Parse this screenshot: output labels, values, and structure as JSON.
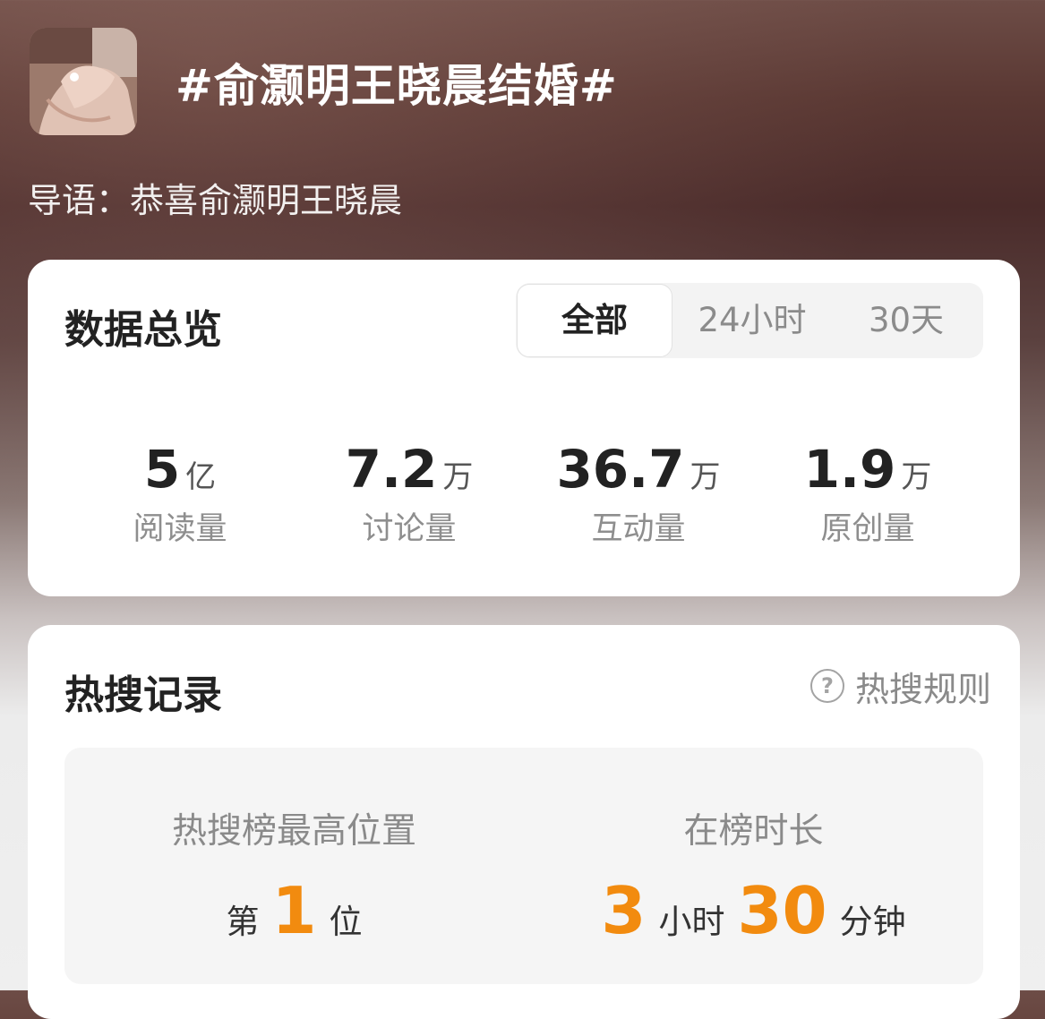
{
  "header": {
    "topic_title": "#俞灏明王晓晨结婚#",
    "intro": "导语：恭喜俞灏明王晓晨"
  },
  "overview": {
    "title": "数据总览",
    "tabs": [
      "全部",
      "24小时",
      "30天"
    ],
    "active_tab": "全部",
    "stats": [
      {
        "value": "5",
        "unit": "亿",
        "label": "阅读量"
      },
      {
        "value": "7.2",
        "unit": "万",
        "label": "讨论量"
      },
      {
        "value": "36.7",
        "unit": "万",
        "label": "互动量"
      },
      {
        "value": "1.9",
        "unit": "万",
        "label": "原创量"
      }
    ]
  },
  "hot_search": {
    "title": "热搜记录",
    "rules_label": "热搜规则",
    "help_icon_glyph": "?",
    "highest_position": {
      "label": "热搜榜最高位置",
      "prefix": "第",
      "value": "1",
      "suffix": "位"
    },
    "duration": {
      "label": "在榜时长",
      "hours": "3",
      "hours_unit": "小时",
      "minutes": "30",
      "minutes_unit": "分钟"
    },
    "accent_color": "#f28b0f"
  },
  "icons": {
    "avatar": "topic-avatar-image",
    "help": "help-circle-icon"
  }
}
